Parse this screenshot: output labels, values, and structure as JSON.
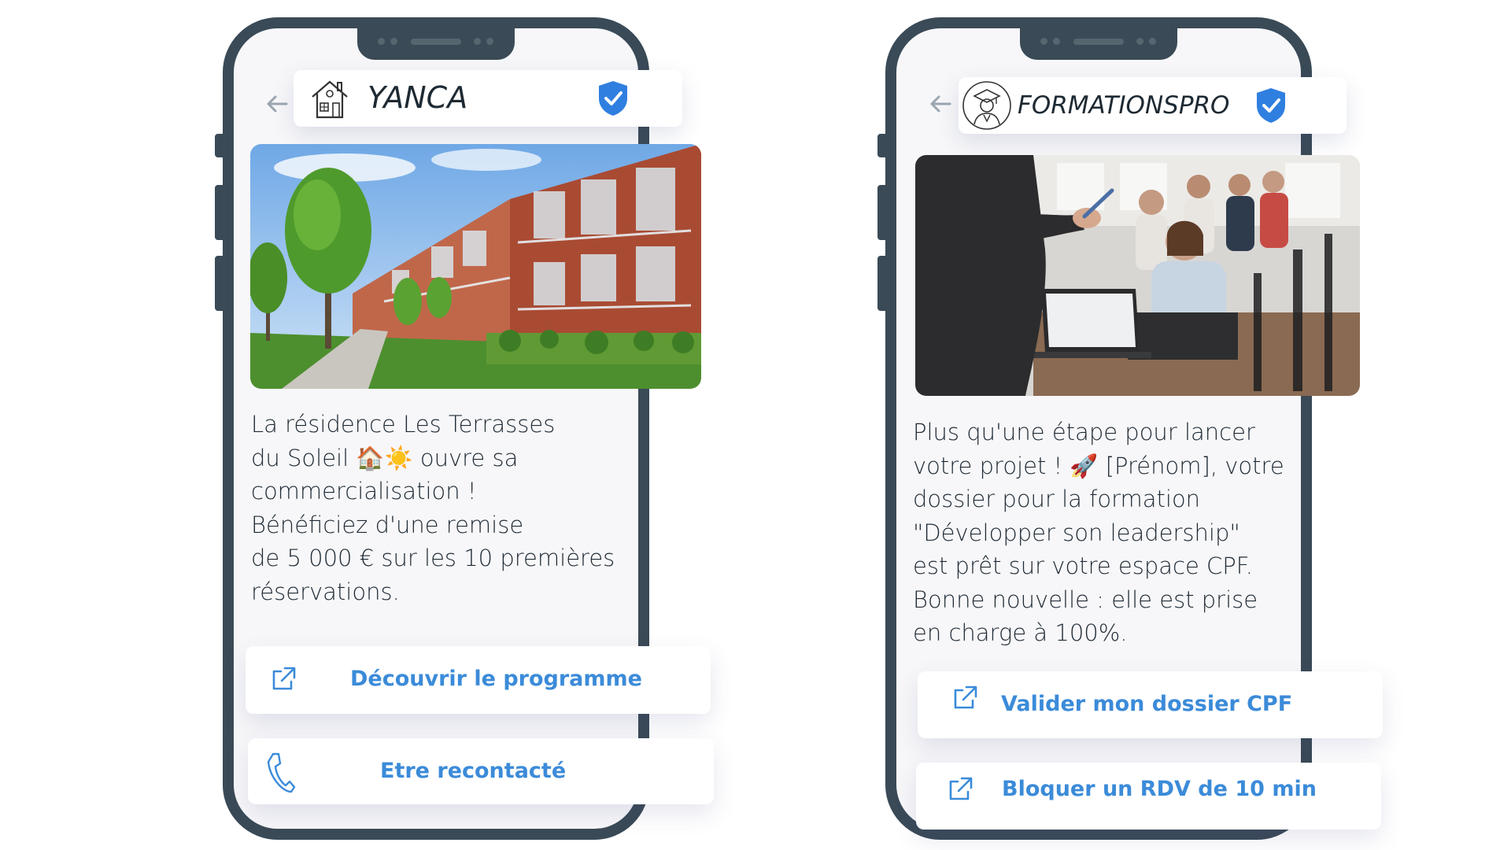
{
  "colors": {
    "phone_frame": "#3a4a57",
    "screen_bg": "#f7f7f9",
    "accent_blue": "#3b8bd9",
    "text_dark": "#1f2a35"
  },
  "phone_left": {
    "sender": {
      "name": "YANCA",
      "logo": "house-logo-icon",
      "verified_icon": "verified-shield-icon",
      "back_icon": "back-arrow-icon"
    },
    "image_alt": "residential-buildings-photo",
    "message": "La résidence Les Terrasses\ndu Soleil 🏠☀️ ouvre sa\ncommercialisation !\nBénéficiez d'une remise\nde 5 000 € sur les 10 premières\nréservations.",
    "buttons": [
      {
        "label": "Découvrir le programme",
        "icon": "external-link-icon"
      },
      {
        "label": "Etre recontacté",
        "icon": "phone-icon"
      }
    ]
  },
  "phone_right": {
    "sender": {
      "name": "FORMATIONSPRO",
      "logo": "graduate-logo-icon",
      "verified_icon": "verified-shield-icon",
      "back_icon": "back-arrow-icon"
    },
    "image_alt": "training-classroom-photo",
    "message": "Plus qu'une étape pour lancer\nvotre projet ! 🚀 [Prénom], votre\ndossier pour la formation\n\"Développer son leadership\"\nest prêt sur votre espace CPF.\nBonne nouvelle : elle est prise\nen charge à 100%.",
    "buttons": [
      {
        "label": "Valider mon dossier CPF",
        "icon": "external-link-icon"
      },
      {
        "label": "Bloquer un RDV de 10 min",
        "icon": "external-link-icon"
      }
    ]
  }
}
